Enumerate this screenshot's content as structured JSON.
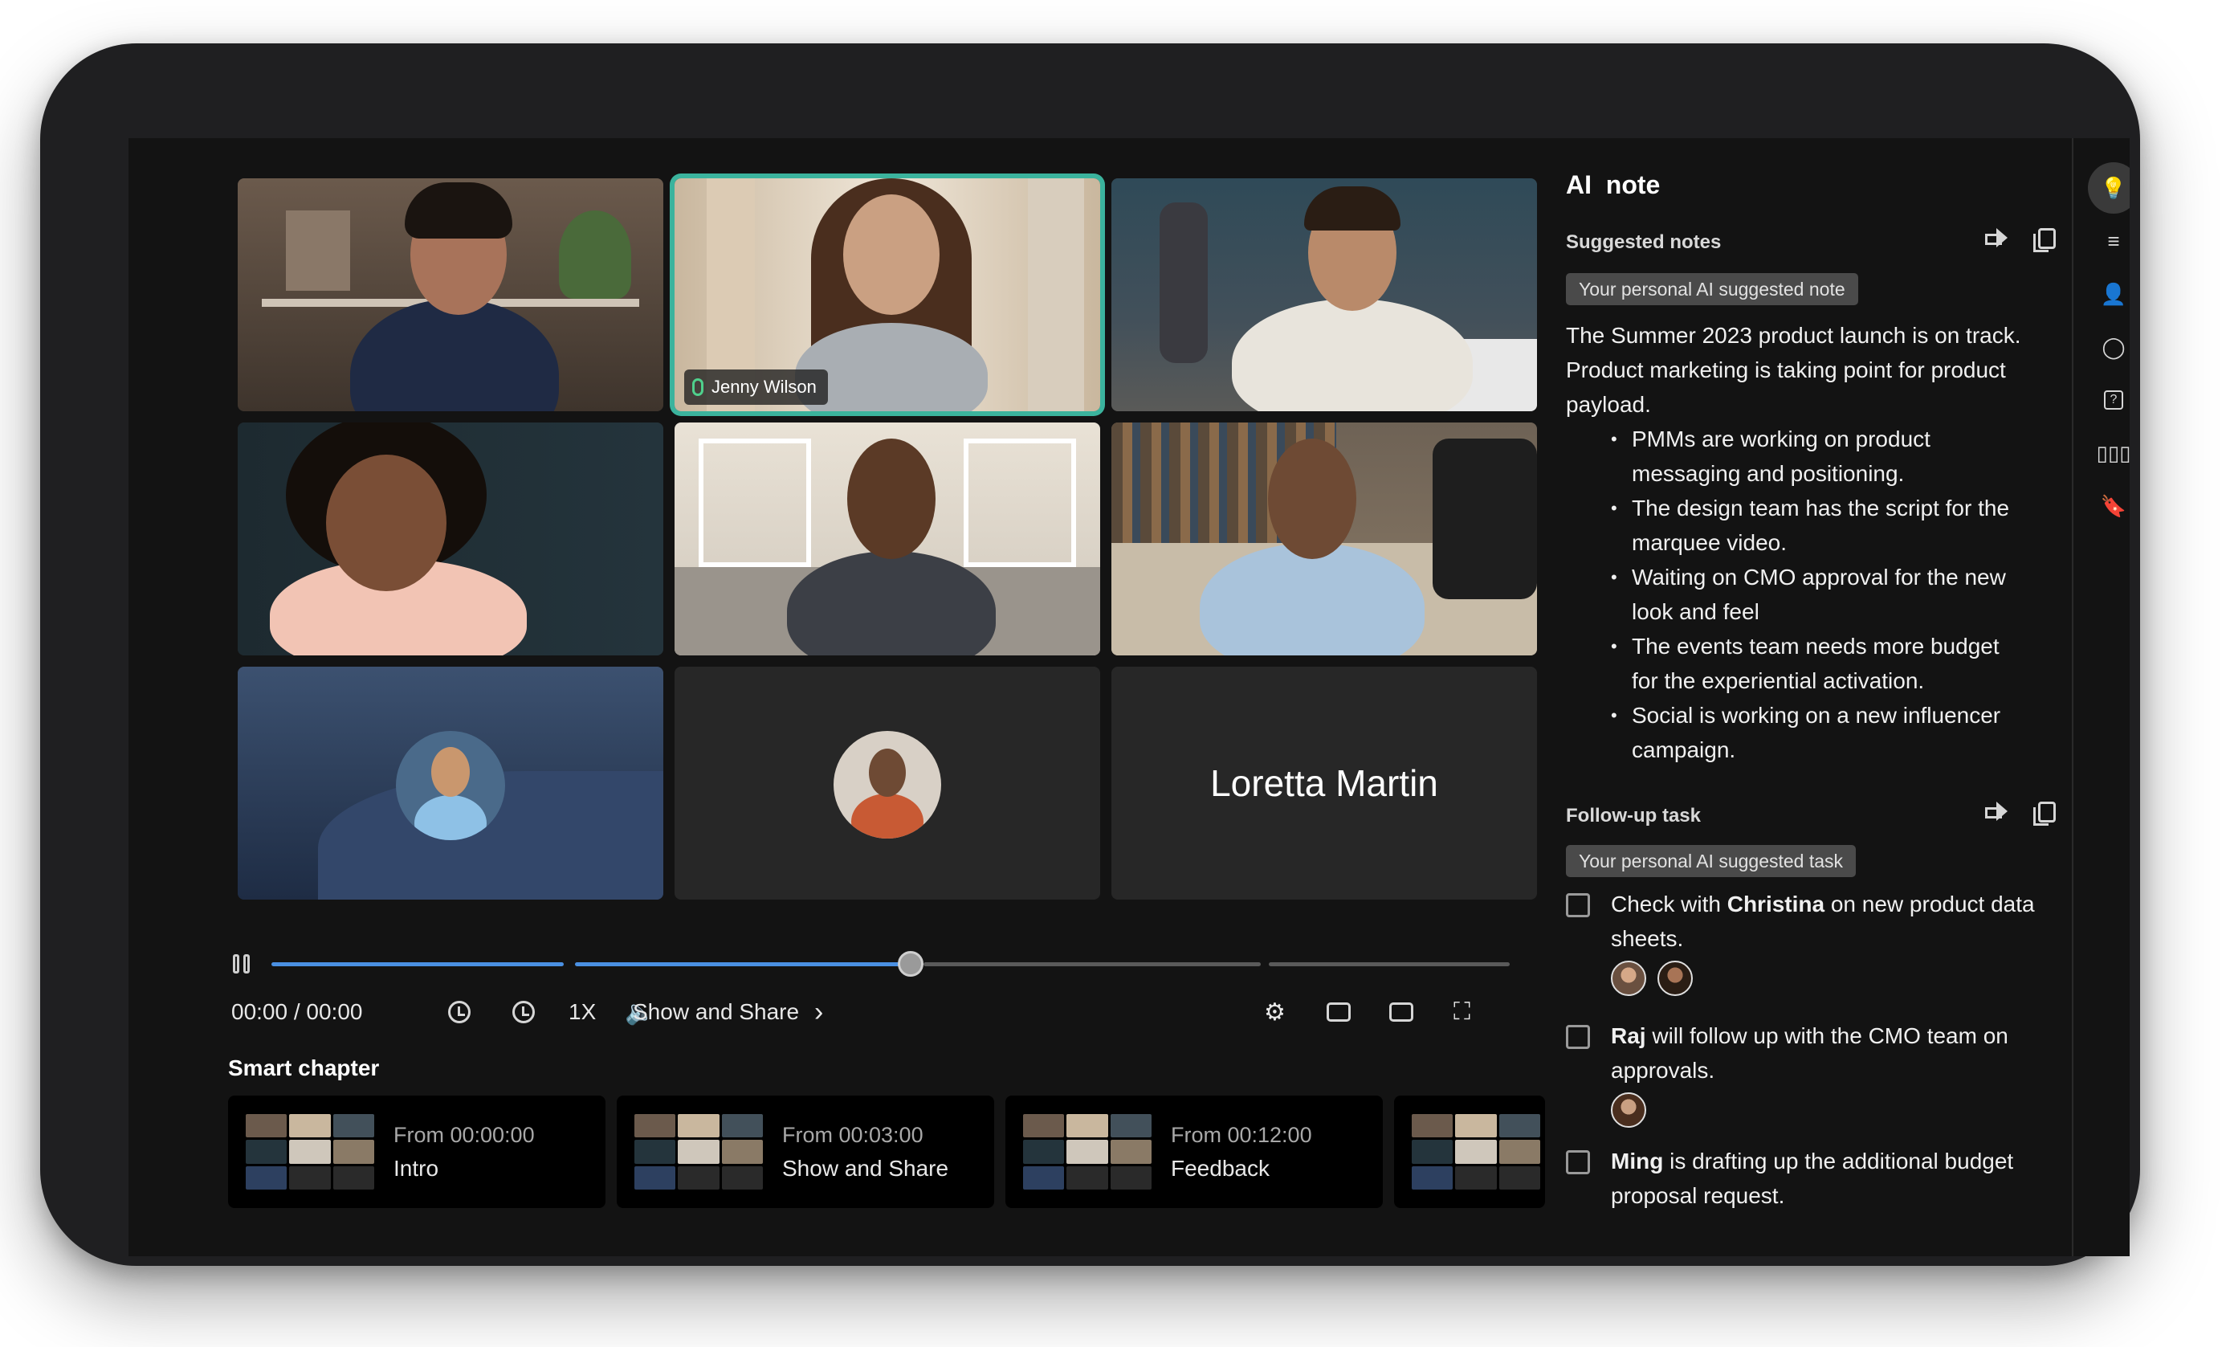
{
  "tiles": [
    {
      "bg": "#5a4a3e",
      "skin": "#a8735a",
      "shirt": "#1f2a44",
      "hair": "#1a1410"
    },
    {
      "bg": "#c9b79e",
      "skin": "#caa082",
      "shirt": "#a9aeb3",
      "hair": "#4a2e1e"
    },
    {
      "bg": "#42505a",
      "skin": "#b98a6a",
      "shirt": "#e8e4dc",
      "hair": "#2a1d14"
    },
    {
      "bg": "#1d2a30",
      "skin": "#7a4e36",
      "shirt": "#f2c4b4",
      "hair": "#140e0a"
    },
    {
      "bg": "#cfc7bb",
      "skin": "#5b3a26",
      "shirt": "#3c3f46",
      "hair": "#1a120c"
    },
    {
      "bg": "#8a7a66",
      "skin": "#6e4a34",
      "shirt": "#a9c3db",
      "hair": "#1a120c"
    }
  ],
  "active_speaker": "Jenny Wilson",
  "name_only_tile": "Loretta Martin",
  "player": {
    "time": "00:00 / 00:00",
    "speed": "1X",
    "chapter_link": "Show and Share",
    "progress": 0.52
  },
  "smart_chapter": {
    "label": "Smart chapter",
    "items": [
      {
        "from": "From 00:00:00",
        "title": "Intro"
      },
      {
        "from": "From 00:03:00",
        "title": "Show and Share"
      },
      {
        "from": "From 00:12:00",
        "title": "Feedback"
      }
    ]
  },
  "ai_note": {
    "title": "AI  note",
    "suggested_heading": "Suggested notes",
    "suggested_pill": "Your personal AI suggested note",
    "summary": "The Summer 2023 product launch is on track. Product marketing is taking point for product payload.",
    "bullets": [
      "PMMs are working on product messaging and positioning.",
      "The design team has the script for the marquee video.",
      "Waiting on CMO approval for the new look and feel",
      "The events team needs more budget for the experiential activation.",
      "Social is working on a new influencer campaign."
    ],
    "followup_heading": "Follow-up task",
    "followup_pill": "Your personal AI suggested task",
    "tasks": [
      {
        "pre": "Check with ",
        "bold": "Christina",
        "post": " on new product data sheets."
      },
      {
        "pre": "",
        "bold": "Raj",
        "post": " will follow up with the CMO team on approvals."
      },
      {
        "pre": "",
        "bold": "Ming",
        "post": " is drafting up the additional budget proposal request."
      }
    ]
  },
  "colors": {
    "accent": "#3bb39d",
    "progress": "#4a90e2"
  },
  "rail_icons": [
    "lightbulb-icon",
    "list-icon",
    "people-icon",
    "chat-icon",
    "question-icon",
    "stats-icon",
    "bookmark-icon"
  ]
}
